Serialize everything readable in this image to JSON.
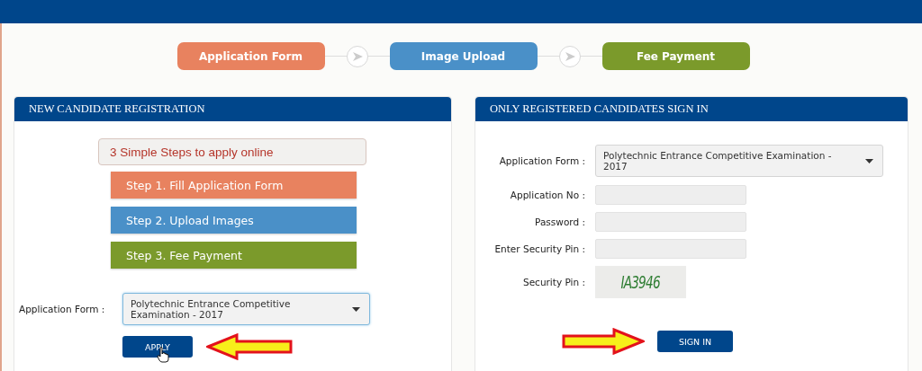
{
  "steps": [
    {
      "label": "Application Form",
      "color": "#e8825f"
    },
    {
      "label": "Image Upload",
      "color": "#4a90c8"
    },
    {
      "label": "Fee Payment",
      "color": "#7b9a2b"
    }
  ],
  "registration": {
    "title": "NEW CANDIDATE REGISTRATION",
    "intro": "3 Simple Steps to apply online",
    "steps": [
      {
        "label": "Step 1. Fill Application Form",
        "color": "#e8825f"
      },
      {
        "label": "Step 2. Upload Images",
        "color": "#4a90c8"
      },
      {
        "label": "Step 3. Fee Payment",
        "color": "#7b9a2b"
      }
    ],
    "form_label": "Application Form :",
    "form_value": "Polytechnic Entrance Competitive Examination - 2017",
    "button": "APPLY"
  },
  "sign_in": {
    "title": "ONLY REGISTERED CANDIDATES SIGN IN",
    "fields": [
      {
        "kind": "select",
        "label": "Application Form :",
        "value": "Polytechnic Entrance Competitive Examination - 2017"
      },
      {
        "kind": "input",
        "label": "Application No :"
      },
      {
        "kind": "input",
        "label": "Password :"
      },
      {
        "kind": "input",
        "label": "Enter Security Pin :"
      },
      {
        "kind": "captcha",
        "label": "Security Pin :",
        "value": "IA3946"
      }
    ],
    "button": "SIGN IN"
  }
}
